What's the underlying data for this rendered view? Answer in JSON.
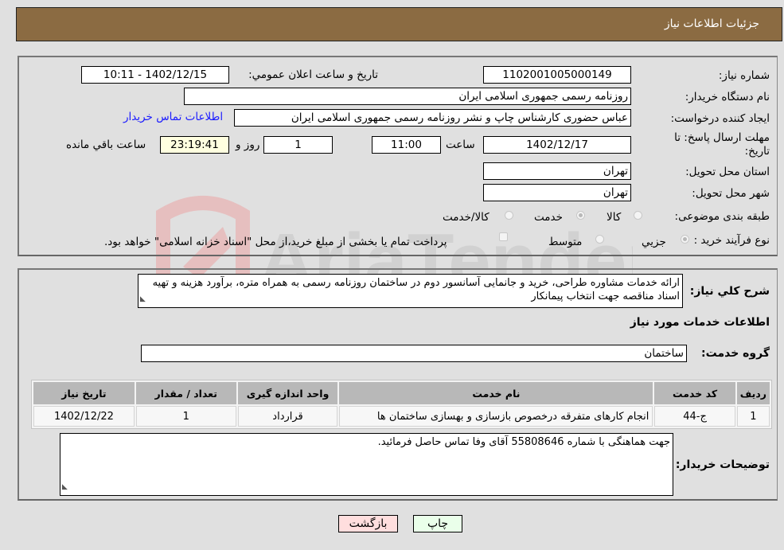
{
  "header": {
    "title": "جزئیات اطلاعات نیاز"
  },
  "form": {
    "need_number": {
      "label": "شماره نیاز:",
      "value": "1102001005000149"
    },
    "announce_datetime": {
      "label": "تاریخ و ساعت اعلان عمومي:",
      "value": "1402/12/15 - 10:11"
    },
    "buyer_org": {
      "label": "نام دستگاه خریدار:",
      "value": "روزنامه رسمی جمهوری اسلامی ایران"
    },
    "requester": {
      "label": "ایجاد کننده درخواست:",
      "value": "عباس حضوری کارشناس چاپ و نشر روزنامه رسمی جمهوری اسلامی ایران"
    },
    "buyer_contact_link": "اطلاعات تماس خریدار",
    "deadline": {
      "label": "مهلت ارسال پاسخ: تا تاریخ:",
      "date": "1402/12/17",
      "time_label": "ساعت",
      "time": "11:00",
      "days": "1",
      "days_label": "روز و",
      "remaining": "23:19:41",
      "remaining_label": "ساعت باقي مانده"
    },
    "province": {
      "label": "استان محل تحویل:",
      "value": "تهران"
    },
    "city": {
      "label": "شهر محل تحویل:",
      "value": "تهران"
    },
    "category": {
      "label": "طبقه بندی موضوعی:",
      "options": [
        {
          "label": "کالا",
          "checked": false
        },
        {
          "label": "خدمت",
          "checked": true
        },
        {
          "label": "کالا/خدمت",
          "checked": false
        }
      ]
    },
    "purchase_type": {
      "label": "نوع فرآیند خرید :",
      "options": [
        {
          "label": "جزيي",
          "checked": true
        },
        {
          "label": "متوسط",
          "checked": false
        }
      ],
      "treasury_checkbox_label": "پرداخت تمام یا بخشی از مبلغ خرید،از محل \"اسناد خزانه اسلامی\" خواهد بود."
    }
  },
  "details": {
    "description_label": "شرح کلي نیاز:",
    "description": "ارائه خدمات مشاوره طراحی، خرید و جانمایی آسانسور دوم در ساختمان روزنامه رسمی به همراه متره، برآورد هزینه و تهیه اسناد مناقصه جهت انتخاب پیمانکار",
    "services_heading": "اطلاعات خدمات مورد نیاز",
    "service_group_label": "گروه خدمت:",
    "service_group": "ساختمان",
    "table": {
      "headers": [
        "ردیف",
        "کد خدمت",
        "نام خدمت",
        "واحد اندازه گیری",
        "تعداد / مقدار",
        "تاریخ نیاز"
      ],
      "rows": [
        [
          "1",
          "ج-44",
          "انجام کارهای متفرقه درخصوص بازسازی و بهسازی ساختمان ها",
          "قرارداد",
          "1",
          "1402/12/22"
        ]
      ]
    },
    "buyer_notes_label": "توضیحات خریدار:",
    "buyer_notes": "جهت هماهنگی با شماره 55808646 آقای وفا تماس حاصل فرمائید."
  },
  "buttons": {
    "print": "چاپ",
    "back": "بازگشت"
  },
  "watermark": {
    "text": "AriaTender.neT"
  },
  "colors": {
    "header_bg": "#8b6b42",
    "print_bg": "#eaffea",
    "back_bg": "#ffdede",
    "link": "#1a1aff"
  }
}
